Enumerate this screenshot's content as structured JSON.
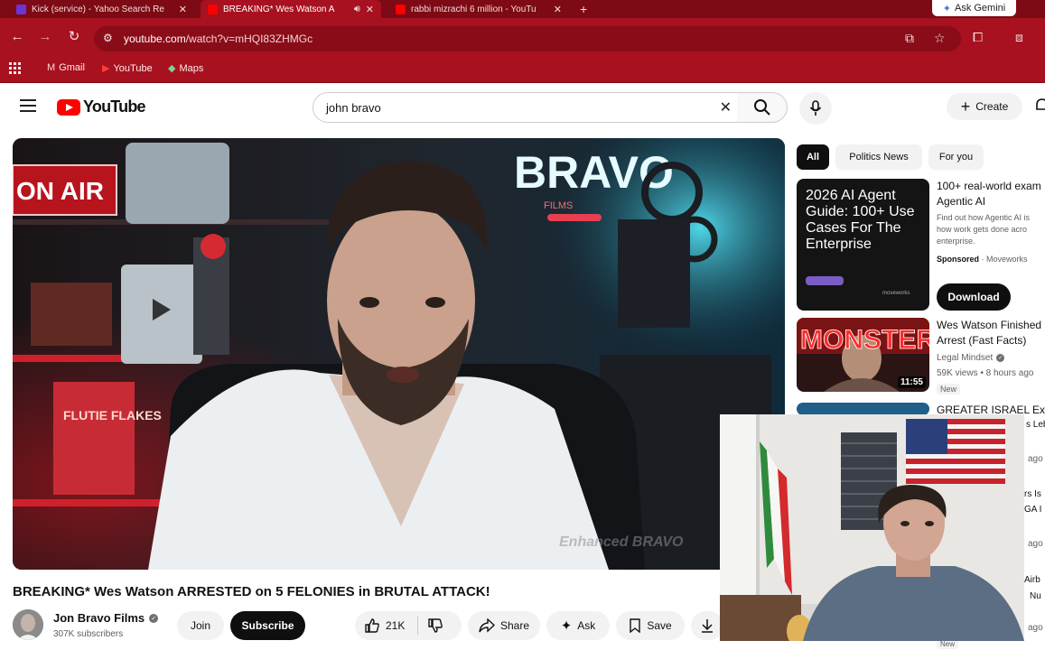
{
  "browser": {
    "tabs": [
      {
        "title": "Kick (service) - Yahoo Search Re",
        "favicon_color": "#6a34d6"
      },
      {
        "title": "BREAKING* Wes Watson A",
        "favicon_color": "#ff0000"
      },
      {
        "title": "rabbi mizrachi 6 million - YouTu",
        "favicon_color": "#ff0000"
      }
    ],
    "ask_gemini": "Ask Gemini",
    "url_domain": "youtube.com",
    "url_path": "/watch?v=mHQI83ZHMGc",
    "bookmarks": [
      {
        "label": "Gmail",
        "icon": "gmail-icon"
      },
      {
        "label": "YouTube",
        "icon": "youtube-icon"
      },
      {
        "label": "Maps",
        "icon": "maps-icon"
      }
    ],
    "accent": "#a8111f"
  },
  "header": {
    "logo": "YouTube",
    "search_query": "john bravo",
    "create": "Create"
  },
  "video": {
    "title": "BREAKING* Wes Watson ARRESTED on 5 FELONIES in BRUTAL ATTACK!",
    "channel": "Jon Bravo Films",
    "subscribers": "307K subscribers",
    "join": "Join",
    "subscribe": "Subscribe",
    "likes": "21K",
    "share": "Share",
    "ask": "Ask",
    "save": "Save",
    "set_text": {
      "on_air": "ON AIR",
      "brand": "BRAVO",
      "brand_sub": "FILMS",
      "poster": "FLUTIE FLAKES",
      "watermark": "Enhanced BRAVO"
    }
  },
  "sidebar": {
    "chips": [
      "All",
      "Politics News",
      "For you"
    ],
    "ad": {
      "thumb_text": "2026 AI Agent Guide: 100+ Use Cases For The Enterprise",
      "thumb_brand": "moveworks",
      "title_lines": [
        "100+ real-world exam",
        "Agentic AI"
      ],
      "desc_lines": [
        "Find out how Agentic AI is",
        "how work gets done acro",
        "enterprise."
      ],
      "sponsored": "Sponsored",
      "advertiser": "Moveworks",
      "cta": "Download"
    },
    "recs": [
      {
        "title_lines": [
          "Wes Watson Finished",
          "Arrest (Fast Facts)"
        ],
        "channel": "Legal Mindset",
        "meta": "59K views • 8 hours ago",
        "badge": "New",
        "duration": "11:55",
        "thumb_text": "MONSTER"
      },
      {
        "title_lines": [
          "GREATER ISRAEL Exp"
        ],
        "peek_text": "s Leb"
      }
    ],
    "peek_right": [
      "ago",
      "rs Is",
      "GA I",
      "ago",
      "Airb",
      "Nu",
      "ago"
    ],
    "bottom_badge": "New"
  }
}
